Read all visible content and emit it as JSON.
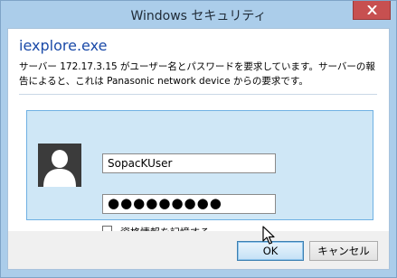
{
  "window": {
    "title": "Windows セキュリティ"
  },
  "dialog": {
    "app_name": "iexplore.exe",
    "message": "サーバー 172.17.3.15 がユーザー名とパスワードを要求しています。サーバーの報告によると、これは Panasonic network device からの要求です。"
  },
  "credentials": {
    "username_value": "SopacKUser",
    "password_mask": "●●●●●●●●●",
    "remember_label": "資格情報を記憶する",
    "remember_checked": false
  },
  "buttons": {
    "ok_label": "OK",
    "cancel_label": "キャンセル"
  },
  "icons": {
    "close": "close-icon",
    "avatar": "user-avatar-icon",
    "cursor": "mouse-pointer-icon"
  },
  "colors": {
    "titlebar": "#abcdea",
    "close_button": "#c75050",
    "panel": "#cfe7f6",
    "app_name": "#1a4aa8"
  }
}
